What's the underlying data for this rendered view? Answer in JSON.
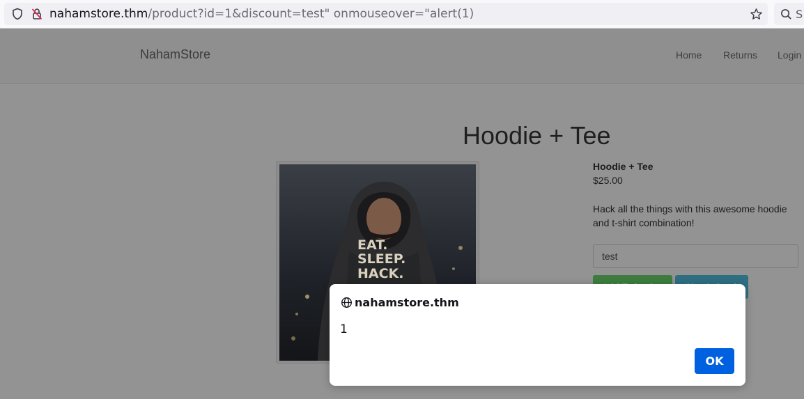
{
  "browser": {
    "url_host": "nahamstore.thm",
    "url_rest": "/product?id=1&discount=test\" onmouseover=\"alert(1)",
    "search_stub": "S"
  },
  "site": {
    "brand": "NahamStore",
    "nav": [
      "Home",
      "Returns",
      "Login"
    ]
  },
  "product": {
    "title": "Hoodie + Tee",
    "name": "Hoodie + Tee",
    "price": "$25.00",
    "description": "Hack all the things with this awesome hoodie and t-shirt combination!",
    "discount_value": "test",
    "add_button": "Add To basket",
    "stock_button": "Check Stock",
    "image_text": [
      "EAT.",
      "SLEEP.",
      "HACK."
    ]
  },
  "dialog": {
    "origin": "nahamstore.thm",
    "message": "1",
    "ok_label": "OK"
  },
  "colors": {
    "ok_button": "#0061e0",
    "overlay": "#939393"
  }
}
